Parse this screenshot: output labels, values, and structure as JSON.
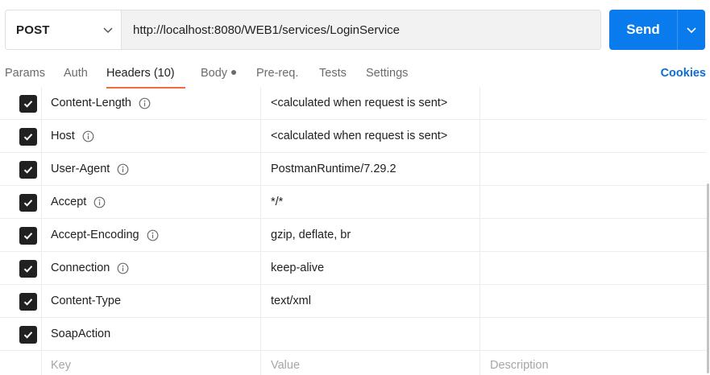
{
  "request": {
    "method": "POST",
    "url": "http://localhost:8080/WEB1/services/LoginService",
    "send_label": "Send"
  },
  "tabs": [
    {
      "label": "Params",
      "active": false
    },
    {
      "label": "Auth",
      "active": false
    },
    {
      "label": "Headers (10)",
      "active": true
    },
    {
      "label": "Body",
      "active": false,
      "has_dot": true
    },
    {
      "label": "Pre-req.",
      "active": false
    },
    {
      "label": "Tests",
      "active": false
    },
    {
      "label": "Settings",
      "active": false
    }
  ],
  "cookies_label": "Cookies",
  "headers": [
    {
      "key": "Content-Length",
      "value": "<calculated when request is sent>",
      "checked": true,
      "info": true
    },
    {
      "key": "Host",
      "value": "<calculated when request is sent>",
      "checked": true,
      "info": true
    },
    {
      "key": "User-Agent",
      "value": "PostmanRuntime/7.29.2",
      "checked": true,
      "info": true
    },
    {
      "key": "Accept",
      "value": "*/*",
      "checked": true,
      "info": true
    },
    {
      "key": "Accept-Encoding",
      "value": "gzip, deflate, br",
      "checked": true,
      "info": true
    },
    {
      "key": "Connection",
      "value": "keep-alive",
      "checked": true,
      "info": true
    },
    {
      "key": "Content-Type",
      "value": "text/xml",
      "checked": true,
      "info": false
    },
    {
      "key": "SoapAction",
      "value": "",
      "checked": true,
      "info": false
    }
  ],
  "new_row": {
    "key_placeholder": "Key",
    "value_placeholder": "Value",
    "description_placeholder": "Description"
  },
  "colors": {
    "accent_send": "#097bed",
    "tab_underline": "#f26b3a",
    "cookies_link": "#0b6dd6",
    "checkbox": "#212121"
  }
}
